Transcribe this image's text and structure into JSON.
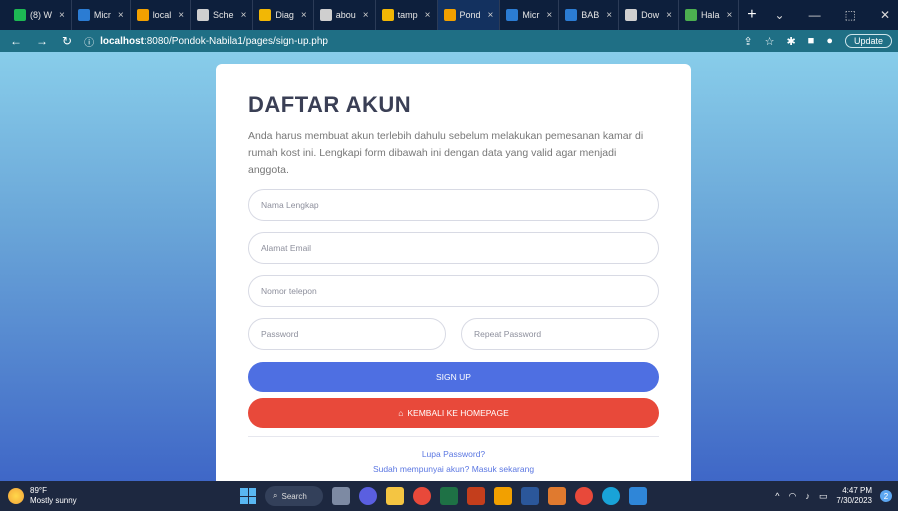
{
  "browser": {
    "tabs": [
      {
        "label": "(8) W",
        "color": "#1db954"
      },
      {
        "label": "Micr",
        "color": "#2b7cd3"
      },
      {
        "label": "local",
        "color": "#f2a000"
      },
      {
        "label": "Sche",
        "color": "#cfcfcf"
      },
      {
        "label": "Diag",
        "color": "#f2b705"
      },
      {
        "label": "abou",
        "color": "#cfcfcf"
      },
      {
        "label": "tamp",
        "color": "#f2b705"
      },
      {
        "label": "Pond",
        "color": "#f2a000",
        "active": true
      },
      {
        "label": "Micr",
        "color": "#2b7cd3"
      },
      {
        "label": "BAB",
        "color": "#2b7cd3"
      },
      {
        "label": "Dow",
        "color": "#cfcfcf"
      },
      {
        "label": "Hala",
        "color": "#4caf50"
      }
    ],
    "tab_close": "×",
    "new_tab": "+",
    "url_prefix": "localhost",
    "url_rest": ":8080/Pondok-Nabila1/pages/sign-up.php",
    "update_label": "Update"
  },
  "form": {
    "title": "DAFTAR AKUN",
    "description": "Anda harus membuat akun terlebih dahulu sebelum melakukan pemesanan kamar di rumah kost ini. Lengkapi form dibawah ini dengan data yang valid agar menjadi anggota.",
    "fields": {
      "name_placeholder": "Nama Lengkap",
      "email_placeholder": "Alamat Email",
      "phone_placeholder": "Nomor telepon",
      "password_placeholder": "Password",
      "repeat_password_placeholder": "Repeat Password"
    },
    "signup_label": "SIGN UP",
    "home_label": "KEMBALI KE HOMEPAGE",
    "forgot_password": "Lupa Password?",
    "login_link": "Sudah mempunyai akun? Masuk sekarang"
  },
  "taskbar": {
    "temperature": "89°F",
    "weather": "Mostly sunny",
    "search_label": "Search",
    "time": "4:47 PM",
    "date": "7/30/2023",
    "notifications": "2"
  },
  "colors": {
    "primary": "#4e6fe2",
    "danger": "#e8493a"
  }
}
